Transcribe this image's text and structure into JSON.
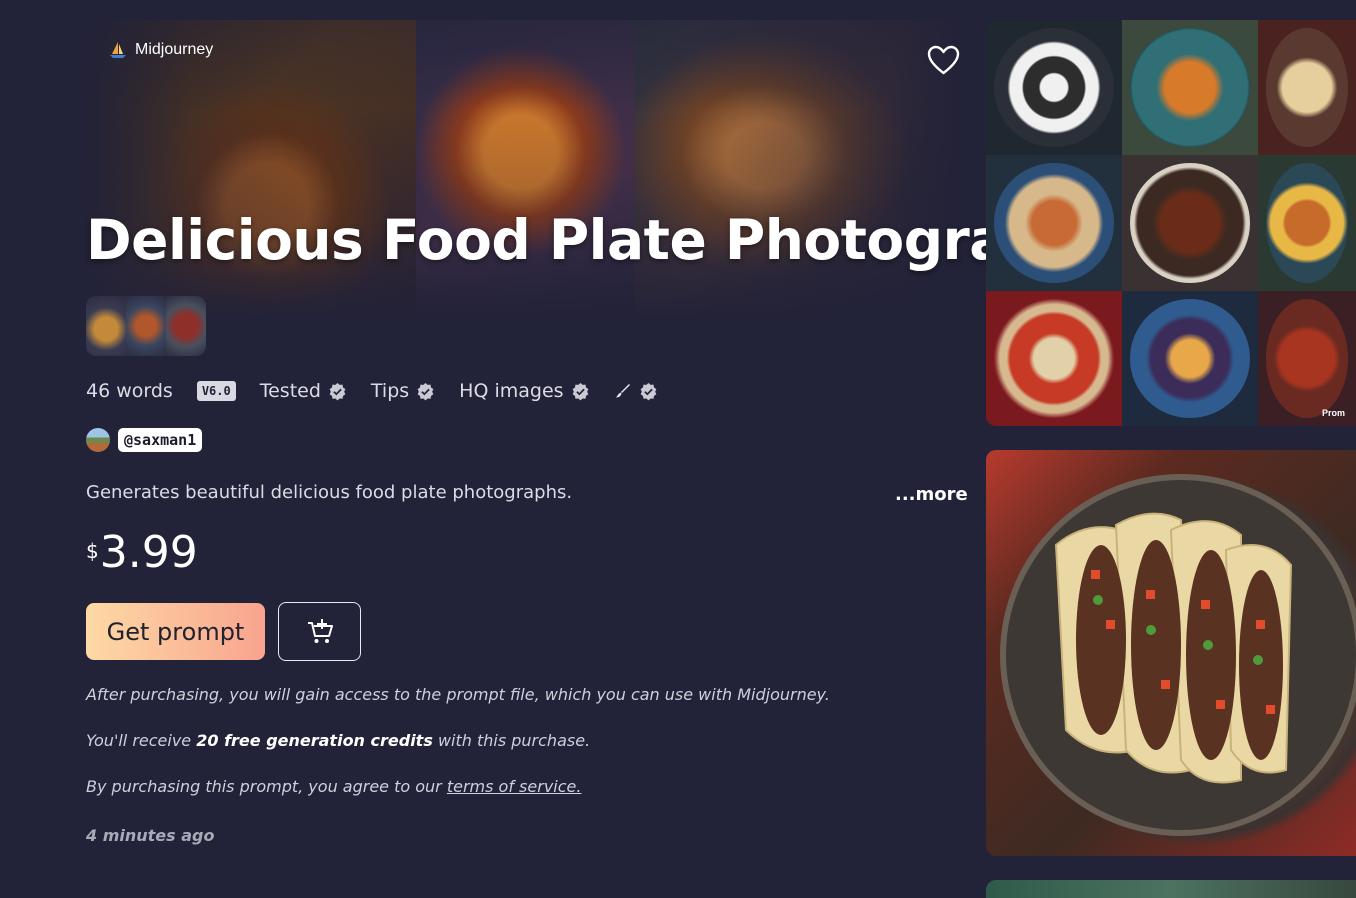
{
  "brand": {
    "name": "Midjourney"
  },
  "header": {
    "title": "Delicious Food Plate Photography"
  },
  "features": {
    "words": "46 words",
    "version": "V6.0",
    "tested": "Tested",
    "tips": "Tips",
    "hq_images": "HQ images"
  },
  "author": {
    "handle": "@saxman1"
  },
  "description": {
    "text": "Generates beautiful delicious food plate photographs.",
    "more_label": "...more"
  },
  "price": {
    "currency": "$",
    "amount": "3.99"
  },
  "actions": {
    "get_prompt_label": "Get prompt"
  },
  "notes": {
    "purchase_info": "After purchasing, you will gain access to the prompt file, which you can use with Midjourney.",
    "credits_prefix": "You'll receive ",
    "credits_bold": "20 free generation credits",
    "credits_suffix": " with this purchase.",
    "tos_prefix": "By purchasing this prompt, you agree to our ",
    "tos_link": "terms of service."
  },
  "timestamp": "4 minutes ago",
  "gallery": {
    "watermark": "Prom",
    "icons": [
      "heart-icon",
      "cart-plus-icon",
      "verified-check-icon",
      "brush-icon",
      "midjourney-boat-icon"
    ]
  },
  "colors": {
    "background": "#222238",
    "button_gradient_start": "#fdd9a4",
    "button_gradient_end": "#f9a48f"
  }
}
